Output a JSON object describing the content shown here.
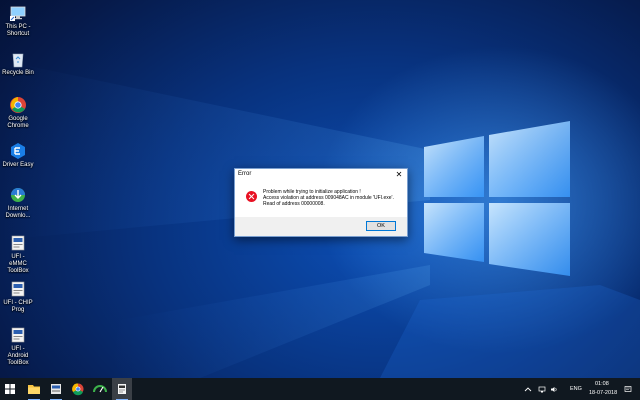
{
  "desktop": {
    "icons": [
      {
        "label": "This PC - Shortcut",
        "icon": "this-pc-icon"
      },
      {
        "label": "Recycle Bin",
        "icon": "recycle-bin-icon"
      },
      {
        "label": "Google Chrome",
        "icon": "chrome-icon"
      },
      {
        "label": "Driver Easy",
        "icon": "driver-easy-icon"
      },
      {
        "label": "Internet Downlo...",
        "icon": "idm-icon"
      },
      {
        "label": "UFI - eMMC ToolBox",
        "icon": "ufi-icon"
      },
      {
        "label": "UFI - CHIP Prog",
        "icon": "ufi-icon"
      },
      {
        "label": "UFI - Android ToolBox",
        "icon": "ufi-icon"
      }
    ]
  },
  "dialog": {
    "title": "Error",
    "close_glyph": "✕",
    "message_lines": [
      "Problem while trying to initialize application !",
      "Access violation at address 009048AC in module 'UFI.exe'.",
      "Read of address 00000008."
    ],
    "ok_label": "OK"
  },
  "taskbar": {
    "items": [
      "start-icon",
      "search-icon",
      "file-explorer-icon",
      "ufi-app-icon",
      "chrome-icon",
      "driver-easy-icon",
      "ufi-window-icon"
    ],
    "tray": {
      "language": "ENG",
      "time": "01:08",
      "date": "18-07-2018"
    }
  },
  "colors": {
    "error_red": "#e81123",
    "accent": "#0078d7",
    "taskbar": "#101820"
  }
}
